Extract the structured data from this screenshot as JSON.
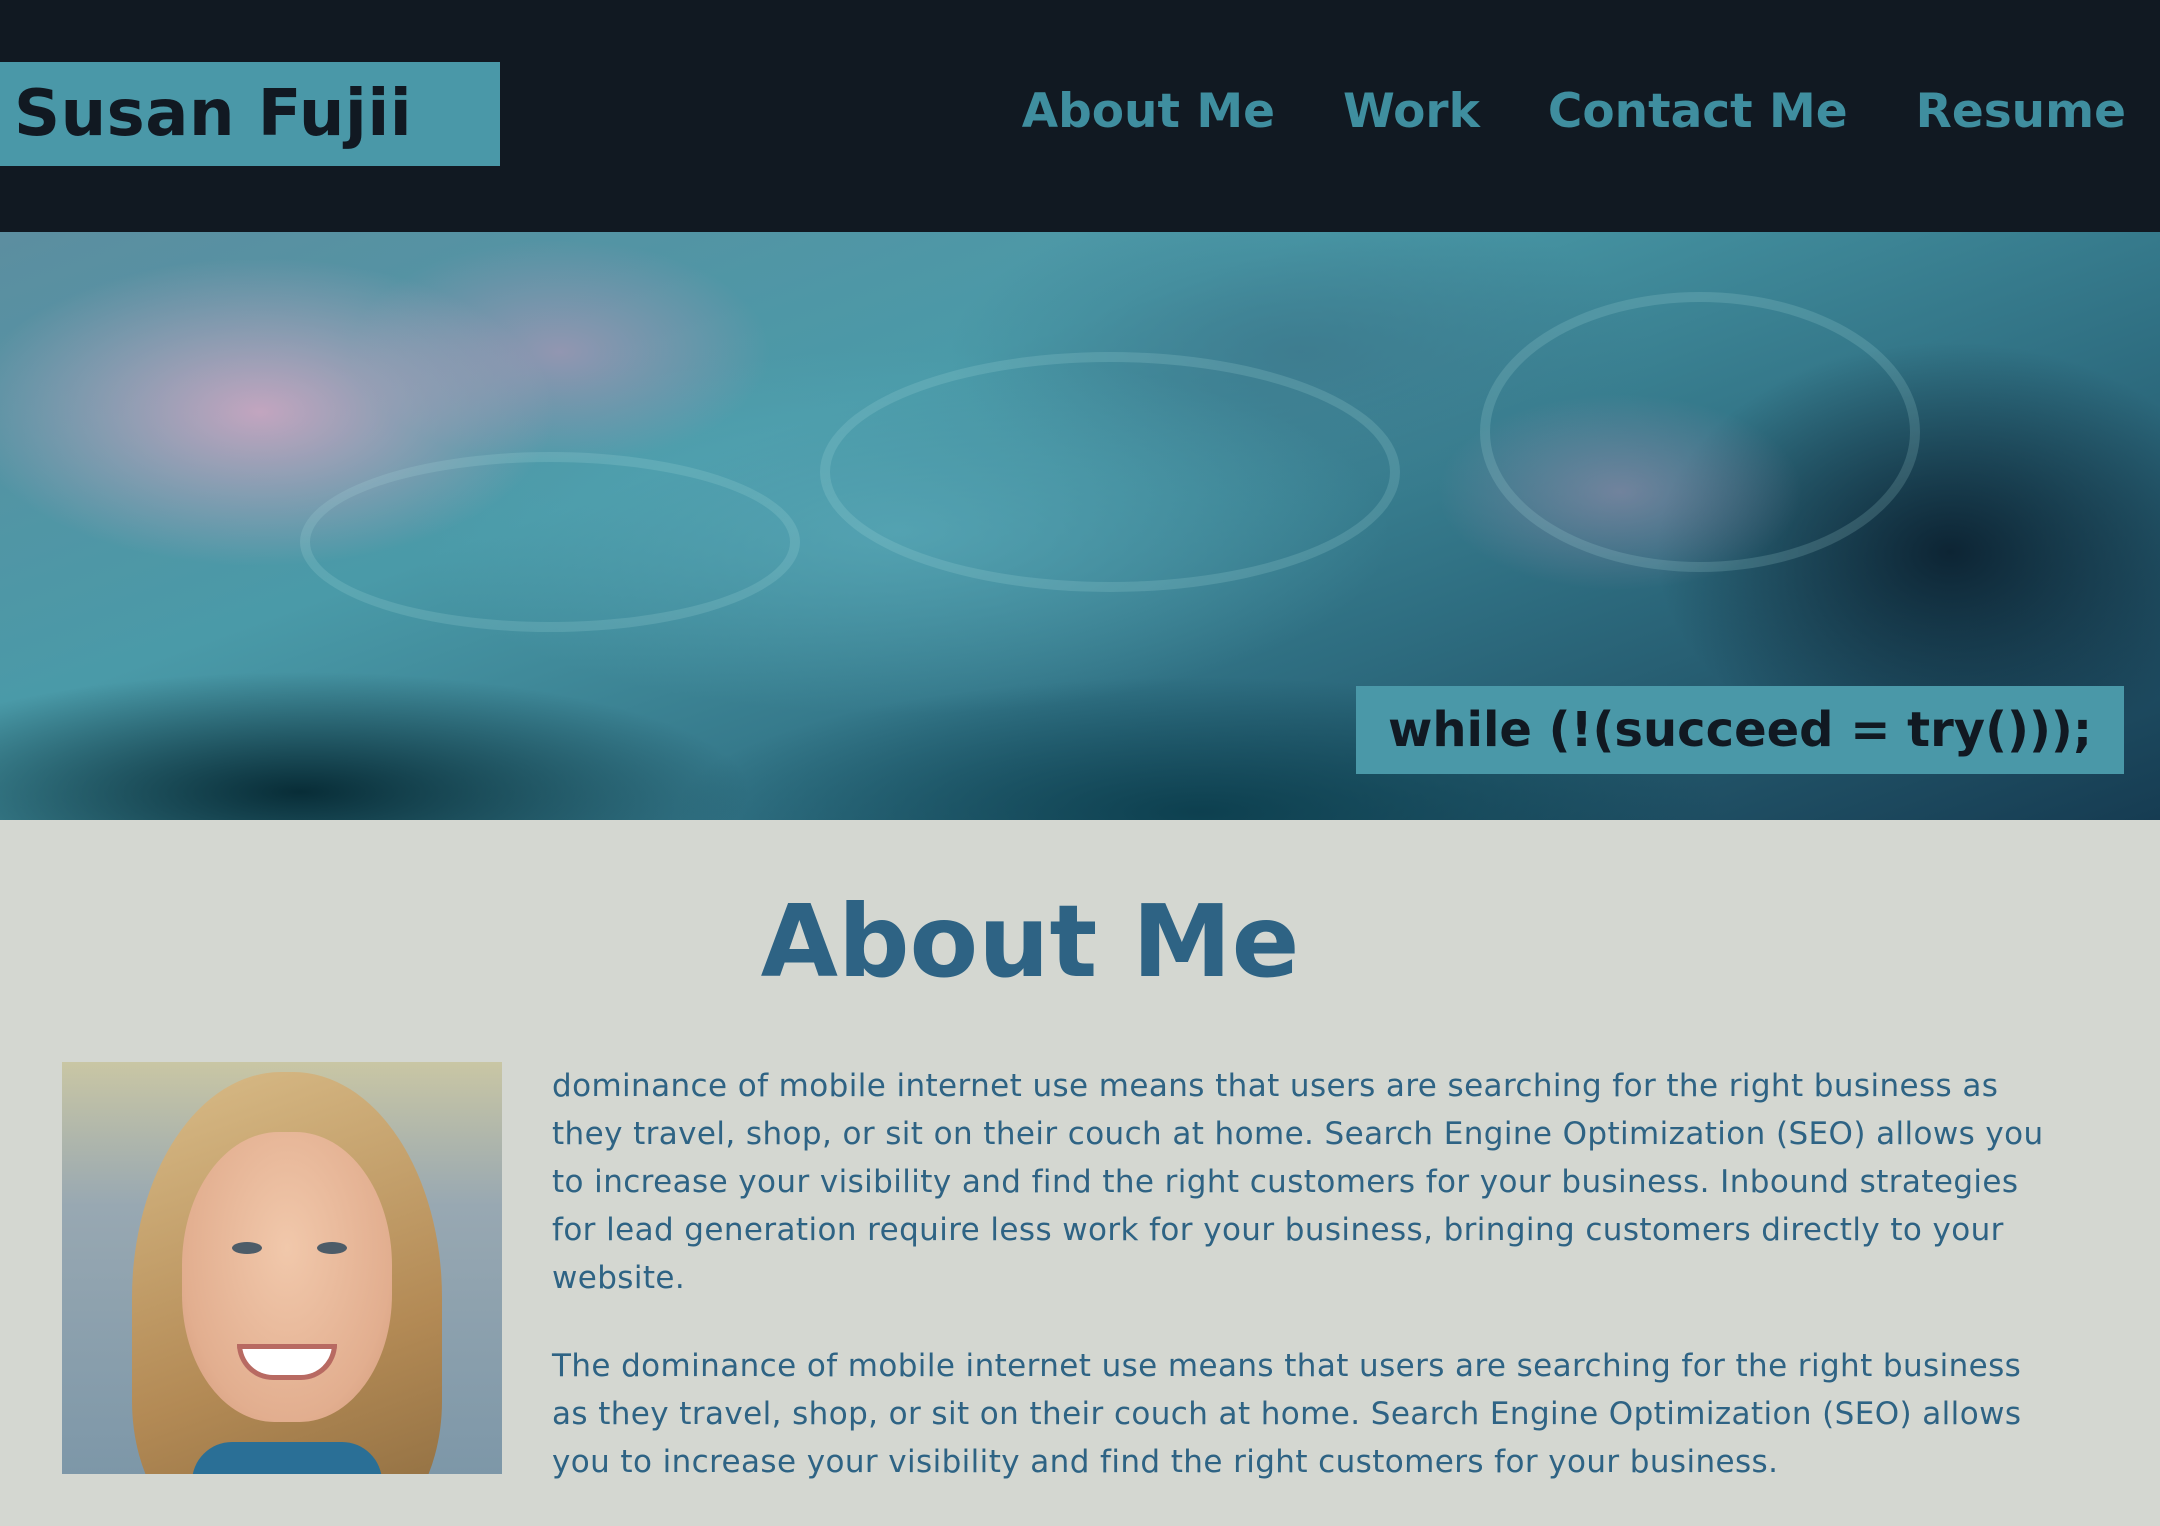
{
  "site": {
    "name": "Susan Fujii"
  },
  "nav": {
    "items": [
      {
        "label": "About Me"
      },
      {
        "label": "Work"
      },
      {
        "label": "Contact Me"
      },
      {
        "label": "Resume"
      }
    ]
  },
  "hero": {
    "quote": "while (!(succeed = try()));"
  },
  "about": {
    "title": "About Me",
    "photo_icon": "profile-photo",
    "paragraphs": [
      "dominance of mobile internet use means that users are searching for the right business as they travel, shop, or sit on their couch at home. Search Engine Optimization (SEO) allows you to increase your visibility and find the right customers for your business. Inbound strategies for lead generation require less work for your business, bringing customers directly to your website.",
      "The dominance of mobile internet use means that users are searching for the right business as they travel, shop, or sit on their couch at home. Search Engine Optimization (SEO) allows you to increase your visibility and find the right customers for your business."
    ]
  },
  "colors": {
    "header_bg": "#111922",
    "accent": "#4a98a8",
    "nav_text": "#3f8e9f",
    "body_bg": "#d4d7d1",
    "heading_text": "#2e6384"
  }
}
